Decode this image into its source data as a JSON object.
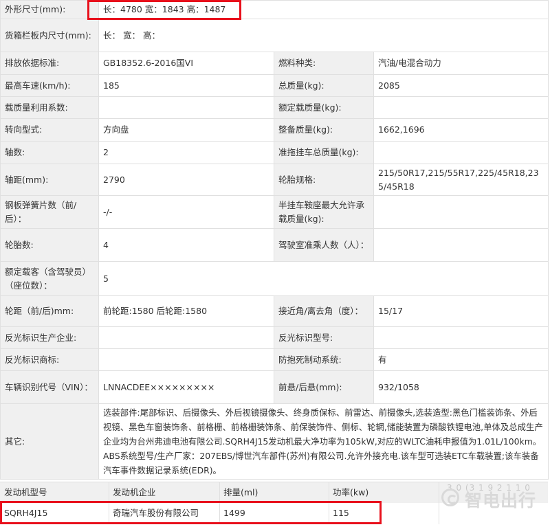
{
  "rows": [
    {
      "l1": "外形尺寸(mm):",
      "v1": "长：4780 宽：1843 高：1487"
    },
    {
      "l1": "货箱栏板内尺寸(mm):",
      "v1": "长：  宽：  高："
    },
    {
      "l1": "排放依据标准:",
      "v1": "GB18352.6-2016国VI",
      "l2": "燃料种类:",
      "v2": "汽油/电混合动力"
    },
    {
      "l1": "最高车速(km/h):",
      "v1": "185",
      "l2": "总质量(kg):",
      "v2": "2085"
    },
    {
      "l1": "载质量利用系数:",
      "v1": "",
      "l2": "额定载质量(kg):",
      "v2": ""
    },
    {
      "l1": "转向型式:",
      "v1": "方向盘",
      "l2": "整备质量(kg):",
      "v2": "1662,1696"
    },
    {
      "l1": "轴数:",
      "v1": "2",
      "l2": "准拖挂车总质量(kg):",
      "v2": ""
    },
    {
      "l1": "轴距(mm):",
      "v1": "2790",
      "l2": "轮胎规格:",
      "v2": "215/50R17,215/55R17,225/45R18,235/45R18"
    },
    {
      "l1": "钢板弹簧片数（前/后）：",
      "v1": "-/-",
      "l2": "半挂车鞍座最大允许承载质量(kg):",
      "v2": ""
    },
    {
      "l1": "轮胎数:",
      "v1": "4",
      "l2": "驾驶室准乘人数（人）：",
      "v2": ""
    },
    {
      "l1": "额定载客（含驾驶员）（座位数）：",
      "v1": "5"
    },
    {
      "l1": "轮距（前/后)mm:",
      "v1": "前轮距:1580 后轮距:1580",
      "l2": "接近角/离去角（度）：",
      "v2": "15/17"
    },
    {
      "l1": "反光标识生产企业:",
      "v1": "",
      "l2": "反光标识型号:",
      "v2": ""
    },
    {
      "l1": "反光标识商标:",
      "v1": "",
      "l2": "防抱死制动系统:",
      "v2": "有"
    },
    {
      "l1": "车辆识别代号（VIN）：",
      "v1": "LNNACDEE×××××××××",
      "l2": "前悬/后悬(mm):",
      "v2": "932/1058"
    },
    {
      "l1": "其它:",
      "v1": "选装部件:尾部标识、后摄像头、外后视镜摄像头、终身质保标、前雷达、前摄像头,选装造型:黑色门槛装饰条、外后视镜、黑色车窗装饰条、前格栅、前格栅装饰条、前保装饰件、侧标、轮辋,储能装置为磷酸铁锂电池,单体及总成生产企业均为台州弗迪电池有限公司.SQRH4J15发动机最大净功率为105kW,对应的WLTC油耗申报值为1.01L/100km。ABS系统型号/生产厂家：207EBS/博世汽车部件(苏州)有限公司.允许外接充电.该车型可选装ETC车载装置;该车装备汽车事件数据记录系统(EDR)。"
    }
  ],
  "engine": {
    "headers": [
      "发动机型号",
      "发动机企业",
      "排量(ml)",
      "功率(kw)"
    ],
    "values": [
      "SQRH4J15",
      "奇瑞汽车股份有限公司",
      "1499",
      "115"
    ]
  },
  "watermark": {
    "text": "智电出行",
    "ghost": "3 0 (3 1 9 2 1 1 0"
  },
  "colors": {
    "highlight": "#e8101c",
    "label_bg": "#f0f0f0",
    "border": "#e0e0e0"
  }
}
